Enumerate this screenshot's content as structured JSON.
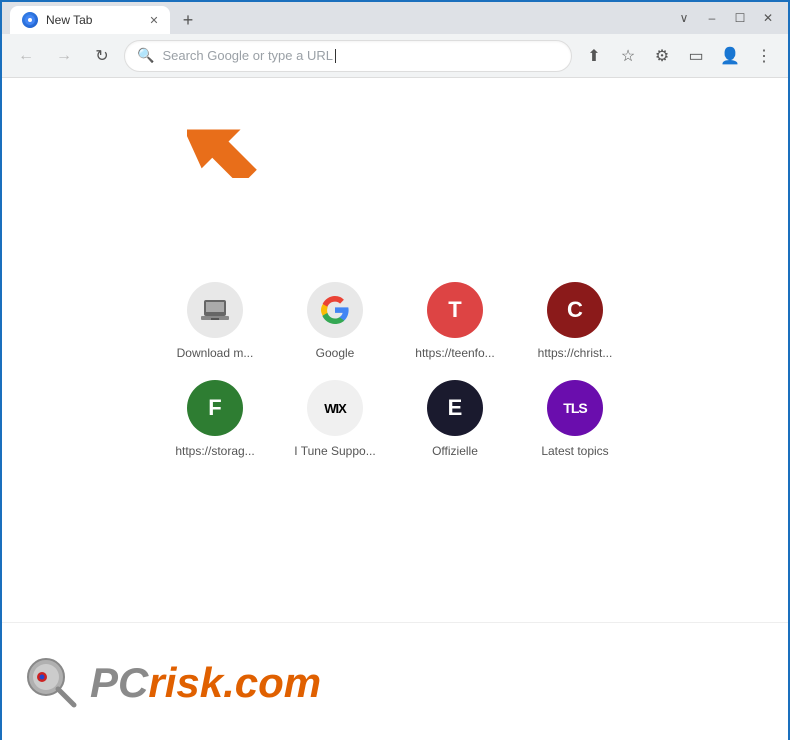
{
  "titlebar": {
    "tab_label": "New Tab",
    "new_tab_icon": "+",
    "win_minimize": "–",
    "win_restore": "☐",
    "win_close": "✕",
    "chevron_down": "∨"
  },
  "navbar": {
    "back_icon": "←",
    "forward_icon": "→",
    "refresh_icon": "↻",
    "search_placeholder": "Search Google or type a URL",
    "share_icon": "⬆",
    "star_icon": "☆",
    "extension_icon": "⚙",
    "cast_icon": "▭",
    "profile_icon": "👤",
    "menu_icon": "⋮"
  },
  "shortcuts": [
    {
      "id": "download",
      "label": "Download m...",
      "favicon_type": "download",
      "favicon_text": "🖨"
    },
    {
      "id": "google",
      "label": "Google",
      "favicon_type": "google",
      "favicon_text": "G"
    },
    {
      "id": "teenforum",
      "label": "https://teenfo...",
      "favicon_type": "teen",
      "favicon_text": "T"
    },
    {
      "id": "christforum",
      "label": "https://christ...",
      "favicon_type": "christ",
      "favicon_text": "C"
    },
    {
      "id": "storage",
      "label": "https://storag...",
      "favicon_type": "storag",
      "favicon_text": "F"
    },
    {
      "id": "wix",
      "label": "I Tune Suppo...",
      "favicon_type": "wix",
      "favicon_text": "WIX"
    },
    {
      "id": "offizielle",
      "label": "Offizielle",
      "favicon_type": "offizielle",
      "favicon_text": "E"
    },
    {
      "id": "latesttopics",
      "label": "Latest topics",
      "favicon_type": "tls",
      "favicon_text": "TLS"
    }
  ],
  "watermark": {
    "brand": "PC",
    "brand_suffix": "risk.com"
  }
}
